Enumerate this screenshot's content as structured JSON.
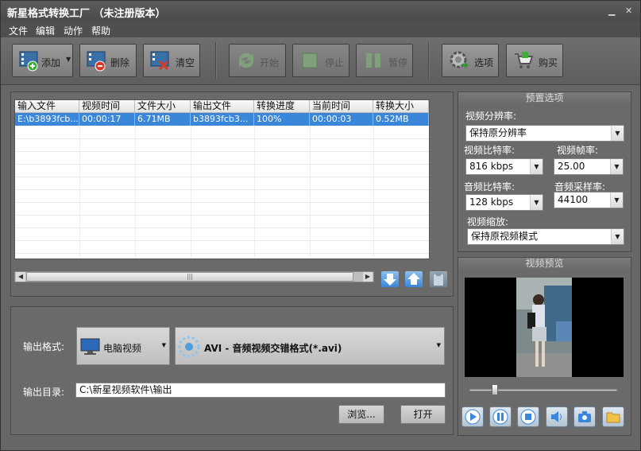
{
  "window": {
    "title": "新星格式转换工厂  （未注册版本）",
    "min_label": "▁",
    "close_label": "✕"
  },
  "menu": [
    "文件",
    "编辑",
    "动作",
    "帮助"
  ],
  "toolbar": {
    "add": "添加",
    "delete": "删除",
    "clear": "清空",
    "start": "开始",
    "stop": "停止",
    "pause": "暂停",
    "options": "选项",
    "buy": "购买"
  },
  "table": {
    "columns": [
      "输入文件",
      "视频时间",
      "文件大小",
      "输出文件",
      "转换进度",
      "当前时间",
      "转换大小"
    ],
    "rows": [
      [
        "E:\\b3893fcb...",
        "00:00:17",
        "6.71MB",
        "b3893fcb3...",
        "100%",
        "00:00:03",
        "0.52MB"
      ]
    ]
  },
  "scroll": {
    "grip": "|||"
  },
  "output": {
    "format_label": "输出格式:",
    "device": "电脑视频",
    "format": "AVI - 音频视频交错格式(*.avi)",
    "dir_label": "输出目录:",
    "dir": "C:\\新星视频软件\\输出",
    "browse": "浏览...",
    "open": "打开"
  },
  "presets": {
    "title": "预置选项",
    "resolution_label": "视频分辨率:",
    "resolution": "保持原分辨率",
    "vbitrate_label": "视频比特率:",
    "vbitrate": "816 kbps",
    "fps_label": "视频帧率:",
    "fps": "25.00",
    "abitrate_label": "音频比特率:",
    "abitrate": "128 kbps",
    "samplerate_label": "音频采样率:",
    "samplerate": "44100",
    "scale_label": "视频缩放:",
    "scale": "保持原视频模式"
  },
  "preview": {
    "title": "视频预览",
    "slider_value": 0.15
  },
  "colors": {
    "selection": "#3a86d8",
    "panel": "#6a6a6a"
  }
}
